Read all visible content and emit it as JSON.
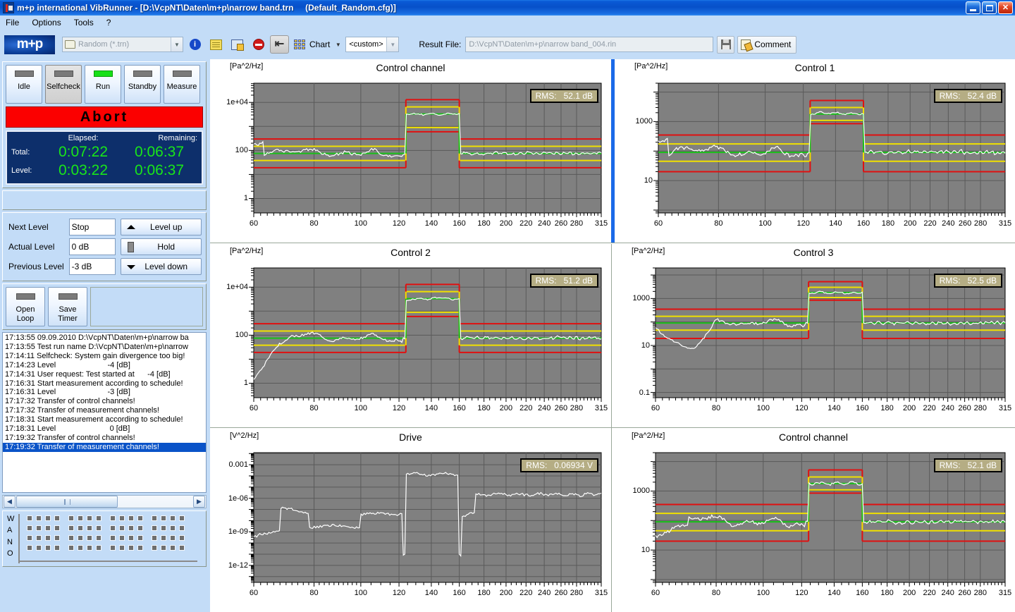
{
  "window": {
    "title": "m+p international VibRunner - [D:\\VcpNT\\Daten\\m+p\\narrow band.trn     (Default_Random.cfg)]",
    "minimize_label": "Minimize",
    "maximize_label": "Maximize",
    "close_label": "Close"
  },
  "menu": {
    "items": [
      "File",
      "Options",
      "Tools",
      "?"
    ]
  },
  "toolbar": {
    "logo": "m+p",
    "file_combo_value": "Random (*.trn)",
    "info_tip": "Info",
    "notes_tip": "Notes",
    "report_tip": "Report",
    "stop_tip": "Stop",
    "back_tip": "Back",
    "chart_label": "Chart",
    "custom_combo_value": "<custom>",
    "result_file_label": "Result File:",
    "result_file_value": "D:\\VcpNT\\Daten\\m+p\\narrow band_004.rin",
    "save_tip": "Save",
    "comment_label": "Comment"
  },
  "sidebar": {
    "states": [
      {
        "label": "Idle",
        "lamp": "off",
        "active": false
      },
      {
        "label": "Selfcheck",
        "lamp": "off",
        "active": true
      },
      {
        "label": "Run",
        "lamp": "on",
        "active": false
      },
      {
        "label": "Standby",
        "lamp": "off",
        "active": false
      },
      {
        "label": "Measure",
        "lamp": "off",
        "active": false
      }
    ],
    "abort_label": "Abort",
    "timer": {
      "elapsed_header": "Elapsed:",
      "remaining_header": "Remaining:",
      "total_label": "Total:",
      "total_elapsed": "0:07:22",
      "total_remaining": "0:06:37",
      "level_label": "Level:",
      "level_elapsed": "0:03:22",
      "level_remaining": "0:06:37"
    },
    "levels": {
      "next_label": "Next Level",
      "next_value": "Stop",
      "actual_label": "Actual Level",
      "actual_value": "0 dB",
      "previous_label": "Previous Level",
      "previous_value": "-3 dB",
      "level_up_label": "Level up",
      "hold_label": "Hold",
      "level_down_label": "Level down"
    },
    "loop_buttons": [
      {
        "line1": "Open",
        "line2": "Loop"
      },
      {
        "line1": "Save",
        "line2": "Timer"
      }
    ],
    "log": {
      "lines": [
        "17:13:55 09.09.2010 D:\\VcpNT\\Daten\\m+p\\narrow ba",
        "17:13:55 Test run name D:\\VcpNT\\Daten\\m+p\\narrow",
        "17:14:11 Selfcheck: System gain divergence too big!",
        "17:14:23 Level                        -4 [dB]",
        "17:14:31 User request: Test started at      -4 [dB]",
        "17:16:31 Start measurement according to schedule!",
        "17:16:31 Level                        -3 [dB]",
        "17:17:32 Transfer of control channels!",
        "17:17:32 Transfer of measurement channels!",
        "17:18:31 Start measurement according to schedule!",
        "17:18:31 Level                         0 [dB]",
        "17:19:32 Transfer of control channels!",
        "17:19:32 Transfer of measurement channels!"
      ],
      "selected_index": 12
    },
    "wano": {
      "letters": [
        "W",
        "A",
        "N",
        "O"
      ]
    }
  },
  "chart_data": [
    {
      "id": "control-channel-top",
      "type": "line",
      "title": "Control channel",
      "ylabel": "[Pa^2/Hz]",
      "xlabel": "",
      "rms_label": "RMS:",
      "rms_value": "52.1 dB",
      "xscale": "log",
      "yscale": "log",
      "xlim": [
        60,
        315
      ],
      "ylim": [
        0.25,
        63000
      ],
      "xticks": [
        60,
        80,
        100,
        120,
        140,
        160,
        180,
        200,
        220,
        240,
        260,
        280,
        315
      ],
      "yticks": [
        1,
        100,
        10000
      ],
      "yticklabels": [
        "1",
        "100",
        "1e+04"
      ],
      "bands": [
        {
          "name": "low",
          "x": [
            60,
            124
          ],
          "green": 75,
          "yellow": [
            38,
            148
          ],
          "red": [
            19,
            300
          ]
        },
        {
          "name": "peak",
          "x": [
            124,
            160
          ],
          "green": 3300,
          "yellow": [
            900,
            6500
          ],
          "red": [
            600,
            13000
          ]
        },
        {
          "name": "high",
          "x": [
            160,
            315
          ],
          "green": 75,
          "yellow": [
            38,
            148
          ],
          "red": [
            19,
            300
          ]
        }
      ],
      "signal_color": "#ffffff",
      "series_note": "measured PSD with low/peak/high plateaus"
    },
    {
      "id": "control-1",
      "type": "line",
      "title": "Control 1",
      "ylabel": "[Pa^2/Hz]",
      "xlabel": "",
      "rms_label": "RMS:",
      "rms_value": "52.4 dB",
      "xscale": "log",
      "yscale": "log",
      "xlim": [
        60,
        315
      ],
      "ylim": [
        0.8,
        20000
      ],
      "xticks": [
        60,
        80,
        100,
        120,
        140,
        160,
        180,
        200,
        220,
        240,
        260,
        280,
        315
      ],
      "yticks": [
        10,
        1000
      ],
      "yticklabels": [
        "10",
        "1000"
      ],
      "bands": [
        {
          "name": "low",
          "x": [
            60,
            124
          ],
          "green": 90,
          "yellow": [
            45,
            175
          ],
          "red": [
            20,
            350
          ]
        },
        {
          "name": "peak",
          "x": [
            124,
            160
          ],
          "green": 1800,
          "yellow": [
            1100,
            3000
          ],
          "red": [
            850,
            5200
          ]
        },
        {
          "name": "high",
          "x": [
            160,
            315
          ],
          "green": 90,
          "yellow": [
            45,
            175
          ],
          "red": [
            20,
            350
          ]
        }
      ],
      "signal_color": "#ffffff",
      "selected": true
    },
    {
      "id": "control-2",
      "type": "line",
      "title": "Control 2",
      "ylabel": "[Pa^2/Hz]",
      "xlabel": "",
      "rms_label": "RMS:",
      "rms_value": "51.2 dB",
      "xscale": "log",
      "yscale": "log",
      "xlim": [
        60,
        315
      ],
      "ylim": [
        0.25,
        63000
      ],
      "xticks": [
        60,
        80,
        100,
        120,
        140,
        160,
        180,
        200,
        220,
        240,
        260,
        280,
        315
      ],
      "yticks": [
        1,
        100,
        10000
      ],
      "yticklabels": [
        "1",
        "100",
        "1e+04"
      ],
      "bands": [
        {
          "name": "low",
          "x": [
            60,
            124
          ],
          "green": 75,
          "yellow": [
            38,
            148
          ],
          "red": [
            19,
            300
          ]
        },
        {
          "name": "peak",
          "x": [
            124,
            160
          ],
          "green": 3300,
          "yellow": [
            900,
            6500
          ],
          "red": [
            600,
            13000
          ]
        },
        {
          "name": "high",
          "x": [
            160,
            315
          ],
          "green": 75,
          "yellow": [
            38,
            148
          ],
          "red": [
            19,
            300
          ]
        }
      ],
      "signal_color": "#ffffff"
    },
    {
      "id": "control-3",
      "type": "line",
      "title": "Control 3",
      "ylabel": "[Pa^2/Hz]",
      "xlabel": "",
      "rms_label": "RMS:",
      "rms_value": "52.5 dB",
      "xscale": "log",
      "yscale": "log",
      "xlim": [
        60,
        315
      ],
      "ylim": [
        0.06,
        20000
      ],
      "xticks": [
        60,
        80,
        100,
        120,
        140,
        160,
        180,
        200,
        220,
        240,
        260,
        280,
        315
      ],
      "yticks": [
        0.1,
        10,
        1000
      ],
      "yticklabels": [
        "0.1",
        "10",
        "1000"
      ],
      "bands": [
        {
          "name": "low",
          "x": [
            60,
            124
          ],
          "green": 90,
          "yellow": [
            45,
            175
          ],
          "red": [
            20,
            350
          ]
        },
        {
          "name": "peak",
          "x": [
            124,
            160
          ],
          "green": 1800,
          "yellow": [
            1100,
            3000
          ],
          "red": [
            850,
            5200
          ]
        },
        {
          "name": "high",
          "x": [
            160,
            315
          ],
          "green": 90,
          "yellow": [
            45,
            175
          ],
          "red": [
            20,
            350
          ]
        }
      ],
      "signal_color": "#ffffff"
    },
    {
      "id": "drive",
      "type": "line",
      "title": "Drive",
      "ylabel": "[V^2/Hz]",
      "xlabel": "",
      "rms_label": "RMS:",
      "rms_value": "0.06934 V",
      "xscale": "log",
      "yscale": "log",
      "xlim": [
        60,
        315
      ],
      "ylim": [
        3e-14,
        0.012
      ],
      "xticks": [
        60,
        80,
        100,
        120,
        140,
        160,
        180,
        200,
        220,
        240,
        260,
        280,
        315
      ],
      "yticks": [
        1e-12,
        1e-09,
        1e-06,
        0.001
      ],
      "yticklabels": [
        "1e-12",
        "1e-09",
        "1e-06",
        "0.001"
      ],
      "bands": [],
      "signal_color": "#ffffff"
    },
    {
      "id": "control-channel-bottom",
      "type": "line",
      "title": "Control channel",
      "ylabel": "[Pa^2/Hz]",
      "xlabel": "",
      "rms_label": "RMS:",
      "rms_value": "52.1 dB",
      "xscale": "log",
      "yscale": "log",
      "xlim": [
        60,
        315
      ],
      "ylim": [
        0.8,
        20000
      ],
      "xticks": [
        60,
        80,
        100,
        120,
        140,
        160,
        180,
        200,
        220,
        240,
        260,
        280,
        315
      ],
      "yticks": [
        10,
        1000
      ],
      "yticklabels": [
        "10",
        "1000"
      ],
      "bands": [
        {
          "name": "low",
          "x": [
            60,
            124
          ],
          "green": 90,
          "yellow": [
            45,
            175
          ],
          "red": [
            20,
            350
          ]
        },
        {
          "name": "peak",
          "x": [
            124,
            160
          ],
          "green": 1800,
          "yellow": [
            1100,
            3000
          ],
          "red": [
            850,
            5200
          ]
        },
        {
          "name": "high",
          "x": [
            160,
            315
          ],
          "green": 90,
          "yellow": [
            45,
            175
          ],
          "red": [
            20,
            350
          ]
        }
      ],
      "signal_color": "#ffffff"
    }
  ],
  "colors": {
    "title_blue": "#0a50c8",
    "panel_blue": "#c3dcf7",
    "plot_gray": "#808080",
    "abort_red": "#fb0000",
    "timer_green": "#19e619",
    "limit_red": "#e01010",
    "limit_yellow": "#f0e000",
    "profile_green": "#18c018",
    "selection_blue": "#0a53c8"
  }
}
